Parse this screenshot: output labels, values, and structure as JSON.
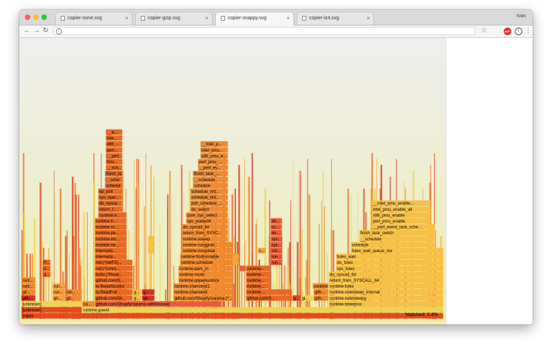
{
  "browser": {
    "tabs": [
      {
        "label": "copier-none.svg",
        "active": false
      },
      {
        "label": "copier-gzip.svg",
        "active": false
      },
      {
        "label": "copier-snappy.svg",
        "active": true
      },
      {
        "label": "copier-lz4.svg",
        "active": false
      }
    ],
    "tab_close_glyph": "×",
    "user_name": "Ivan",
    "url": "",
    "icons": [
      "back-arrow-icon",
      "forward-arrow-icon",
      "reload-icon",
      "info-icon",
      "star-icon",
      "adblock-icon",
      "extension-info-icon",
      "menu-dots-icon"
    ],
    "adblock_label": "ABP"
  },
  "flamegraph": {
    "colors": [
      "#e44b1f",
      "#ea6a24",
      "#ef8a30",
      "#f3a33a",
      "#f6c045",
      "#eed352",
      "#d8332b",
      "#e95c39"
    ],
    "highlight_color": "#d35ad6",
    "frames": [
      {
        "label": "copier",
        "start": 0.0,
        "end": 1.0,
        "depth": 0
      },
      {
        "label": "[unknown]",
        "start": 0.0,
        "end": 0.144,
        "depth": 1
      },
      {
        "label": "runtime.goexit",
        "start": 0.144,
        "end": 1.0,
        "depth": 1
      },
      {
        "label": "[unknown]",
        "start": 0.0,
        "end": 0.144,
        "depth": 2
      },
      {
        "label": "co...",
        "start": 0.144,
        "end": 0.174,
        "depth": 2
      },
      {
        "label": "github.com/Shopify/sarama.withRecover",
        "start": 0.174,
        "end": 0.472,
        "depth": 2
      },
      {
        "label": "runtime.timerproc",
        "start": 0.728,
        "end": 1.0,
        "depth": 2
      },
      {
        "label": "runtime.notetsleepg",
        "start": 0.728,
        "end": 1.0,
        "depth": 3
      },
      {
        "label": "runtime.notetsleep_internal",
        "start": 0.728,
        "end": 1.0,
        "depth": 4
      },
      {
        "label": "runtime.futex",
        "start": 0.728,
        "end": 1.0,
        "depth": 5
      },
      {
        "label": "return_from_SYSCALL_64",
        "start": 0.728,
        "end": 1.0,
        "depth": 6
      },
      {
        "label": "do_syscall_64",
        "start": 0.728,
        "end": 1.0,
        "depth": 7
      },
      {
        "label": "sys_futex",
        "start": 0.745,
        "end": 1.0,
        "depth": 8
      },
      {
        "label": "do_futex",
        "start": 0.745,
        "end": 1.0,
        "depth": 9
      },
      {
        "label": "futex_wait",
        "start": 0.745,
        "end": 1.0,
        "depth": 10
      },
      {
        "label": "futex_wait_queue_me",
        "start": 0.78,
        "end": 1.0,
        "depth": 11
      },
      {
        "label": "schedule",
        "start": 0.78,
        "end": 0.98,
        "depth": 12
      },
      {
        "label": "__schedule",
        "start": 0.8,
        "end": 0.98,
        "depth": 13
      },
      {
        "label": "finish_task_switch",
        "start": 0.8,
        "end": 0.98,
        "depth": 14
      },
      {
        "label": "__perf_event_task_sche...",
        "start": 0.83,
        "end": 0.98,
        "depth": 15
      },
      {
        "label": "perf_pmu_enable",
        "start": 0.83,
        "end": 0.97,
        "depth": 16
      },
      {
        "label": "x86_pmu_enable",
        "start": 0.83,
        "end": 0.97,
        "depth": 17
      },
      {
        "label": "intel_pmu_enable_all",
        "start": 0.83,
        "end": 0.97,
        "depth": 18
      },
      {
        "label": "__intel_pmu_enable...",
        "start": 0.83,
        "end": 0.97,
        "depth": 19
      },
      {
        "label": "github.com/Sh...",
        "start": 0.174,
        "end": 0.264,
        "depth": 3
      },
      {
        "label": "io.ReadFull",
        "start": 0.174,
        "end": 0.264,
        "depth": 4
      },
      {
        "label": "io.ReadAtLeast",
        "start": 0.174,
        "end": 0.264,
        "depth": 5
      },
      {
        "label": "github.com/S...",
        "start": 0.174,
        "end": 0.264,
        "depth": 6
      },
      {
        "label": "bufio.(*Read...",
        "start": 0.174,
        "end": 0.264,
        "depth": 7
      },
      {
        "label": "net.(*conn)...",
        "start": 0.174,
        "end": 0.264,
        "depth": 8
      },
      {
        "label": "net.(*netFD)...",
        "start": 0.174,
        "end": 0.264,
        "depth": 9
      },
      {
        "label": "internal/p...",
        "start": 0.174,
        "end": 0.25,
        "depth": 10
      },
      {
        "label": "internal/p...",
        "start": 0.174,
        "end": 0.25,
        "depth": 11
      },
      {
        "label": "runtime.ne...",
        "start": 0.174,
        "end": 0.25,
        "depth": 12
      },
      {
        "label": "runtime.mc...",
        "start": 0.174,
        "end": 0.25,
        "depth": 13
      },
      {
        "label": "runtime.pa...",
        "start": 0.174,
        "end": 0.25,
        "depth": 14
      },
      {
        "label": "runtime.sc...",
        "start": 0.174,
        "end": 0.25,
        "depth": 15
      },
      {
        "label": "runtime.fi...",
        "start": 0.174,
        "end": 0.25,
        "depth": 16
      },
      {
        "label": "runtime.e...",
        "start": 0.182,
        "end": 0.25,
        "depth": 17
      },
      {
        "label": "return_f...",
        "start": 0.182,
        "end": 0.24,
        "depth": 18
      },
      {
        "label": "do_sysca...",
        "start": 0.182,
        "end": 0.24,
        "depth": 19
      },
      {
        "label": "sys_epol...",
        "start": 0.182,
        "end": 0.24,
        "depth": 20
      },
      {
        "label": "ep_poll",
        "start": 0.182,
        "end": 0.24,
        "depth": 21
      },
      {
        "label": "schedule",
        "start": 0.198,
        "end": 0.24,
        "depth": 22
      },
      {
        "label": "__schedule",
        "start": 0.198,
        "end": 0.24,
        "depth": 23
      },
      {
        "label": "finish_ta...",
        "start": 0.198,
        "end": 0.24,
        "depth": 24
      },
      {
        "label": "__sch...",
        "start": 0.2,
        "end": 0.24,
        "depth": 25
      },
      {
        "label": "finis...",
        "start": 0.2,
        "end": 0.24,
        "depth": 26
      },
      {
        "label": "__perf...",
        "start": 0.2,
        "end": 0.24,
        "depth": 27
      },
      {
        "label": "perf...",
        "start": 0.2,
        "end": 0.24,
        "depth": 28
      },
      {
        "label": "x86_...",
        "start": 0.2,
        "end": 0.24,
        "depth": 29
      },
      {
        "label": "inte...",
        "start": 0.2,
        "end": 0.24,
        "depth": 30
      },
      {
        "label": "__in...",
        "start": 0.2,
        "end": 0.24,
        "depth": 31
      },
      {
        "label": "github.com/Shopify/sarama.(*...",
        "start": 0.36,
        "end": 0.502,
        "depth": 3
      },
      {
        "label": "runtime.chansend",
        "start": 0.36,
        "end": 0.502,
        "depth": 4
      },
      {
        "label": "runtime.chansend1",
        "start": 0.36,
        "end": 0.502,
        "depth": 5
      },
      {
        "label": "runtime.goparkunlock",
        "start": 0.372,
        "end": 0.502,
        "depth": 6
      },
      {
        "label": "runtime.mcall",
        "start": 0.372,
        "end": 0.502,
        "depth": 7
      },
      {
        "label": "runtime.park_m",
        "start": 0.372,
        "end": 0.502,
        "depth": 8
      },
      {
        "label": "runtime.schedule",
        "start": 0.376,
        "end": 0.502,
        "depth": 9
      },
      {
        "label": "runtime.findrunnable",
        "start": 0.376,
        "end": 0.502,
        "depth": 10
      },
      {
        "label": "runtime.runqsteal",
        "start": 0.38,
        "end": 0.502,
        "depth": 11
      },
      {
        "label": "runtime.runqgrab",
        "start": 0.38,
        "end": 0.502,
        "depth": 12
      },
      {
        "label": "runtime.usleep",
        "start": 0.38,
        "end": 0.49,
        "depth": 13
      },
      {
        "label": "return_from_SYSC...",
        "start": 0.38,
        "end": 0.49,
        "depth": 14
      },
      {
        "label": "do_syscall_64",
        "start": 0.38,
        "end": 0.49,
        "depth": 15
      },
      {
        "label": "sys_pselect6",
        "start": 0.39,
        "end": 0.49,
        "depth": 16
      },
      {
        "label": "core_sys_select",
        "start": 0.39,
        "end": 0.49,
        "depth": 17
      },
      {
        "label": "do_select",
        "start": 0.4,
        "end": 0.49,
        "depth": 18
      },
      {
        "label": "poll_schedule_...",
        "start": 0.4,
        "end": 0.49,
        "depth": 19
      },
      {
        "label": "schedule_hrti...",
        "start": 0.4,
        "end": 0.49,
        "depth": 20
      },
      {
        "label": "schedule_hrti...",
        "start": 0.4,
        "end": 0.49,
        "depth": 21
      },
      {
        "label": "schedule",
        "start": 0.406,
        "end": 0.49,
        "depth": 22
      },
      {
        "label": "__schedule",
        "start": 0.406,
        "end": 0.49,
        "depth": 23
      },
      {
        "label": "finish_task_...",
        "start": 0.406,
        "end": 0.49,
        "depth": 24
      },
      {
        "label": "__perf_ev...",
        "start": 0.418,
        "end": 0.49,
        "depth": 25
      },
      {
        "label": "perf_pmu_...",
        "start": 0.418,
        "end": 0.49,
        "depth": 26
      },
      {
        "label": "x86_pmu_e...",
        "start": 0.424,
        "end": 0.49,
        "depth": 27
      },
      {
        "label": "intel_pmu...",
        "start": 0.424,
        "end": 0.49,
        "depth": 28
      },
      {
        "label": "__intel_p...",
        "start": 0.424,
        "end": 0.49,
        "depth": 29
      },
      {
        "label": "github.com/S...",
        "start": 0.532,
        "end": 0.642,
        "depth": 3
      },
      {
        "label": "runtime....",
        "start": 0.532,
        "end": 0.642,
        "depth": 4
      },
      {
        "label": "runtime...",
        "start": 0.532,
        "end": 0.59,
        "depth": 5
      },
      {
        "label": "runtime...",
        "start": 0.532,
        "end": 0.59,
        "depth": 6
      },
      {
        "label": "runtime...",
        "start": 0.532,
        "end": 0.59,
        "depth": 7
      },
      {
        "label": "runtime...",
        "start": 0.532,
        "end": 0.59,
        "depth": 8
      },
      {
        "label": "git...",
        "start": 0.0,
        "end": 0.034,
        "depth": 4
      },
      {
        "label": "runt...",
        "start": 0.0,
        "end": 0.034,
        "depth": 5
      },
      {
        "label": "runt...",
        "start": 0.0,
        "end": 0.034,
        "depth": 6
      },
      {
        "label": "gith...",
        "start": 0.0,
        "end": 0.034,
        "depth": 3
      },
      {
        "label": "git...",
        "start": 0.074,
        "end": 0.104,
        "depth": 3
      },
      {
        "label": "run...",
        "start": 0.074,
        "end": 0.104,
        "depth": 4
      },
      {
        "label": "run...",
        "start": 0.074,
        "end": 0.104,
        "depth": 5
      },
      {
        "label": "git...",
        "start": 0.104,
        "end": 0.144,
        "depth": 3
      },
      {
        "label": "run...",
        "start": 0.104,
        "end": 0.144,
        "depth": 4
      },
      {
        "label": "g...",
        "start": 0.264,
        "end": 0.286,
        "depth": 3
      },
      {
        "label": "g...",
        "start": 0.264,
        "end": 0.286,
        "depth": 4
      },
      {
        "label": "git...",
        "start": 0.286,
        "end": 0.316,
        "depth": 3
      },
      {
        "label": "g...",
        "start": 0.286,
        "end": 0.316,
        "depth": 4
      },
      {
        "label": "g...",
        "start": 0.642,
        "end": 0.662,
        "depth": 3
      },
      {
        "label": "gi...",
        "start": 0.662,
        "end": 0.692,
        "depth": 3
      },
      {
        "label": "gith...",
        "start": 0.692,
        "end": 0.728,
        "depth": 3
      },
      {
        "label": "gith...",
        "start": 0.692,
        "end": 0.728,
        "depth": 4
      },
      {
        "label": "runtime.notesleep",
        "start": 0.69,
        "end": 0.728,
        "depth": 5
      },
      {
        "label": "s...",
        "start": 0.5,
        "end": 0.516,
        "depth": 9
      },
      {
        "label": "s...",
        "start": 0.5,
        "end": 0.516,
        "depth": 10
      },
      {
        "label": "s...",
        "start": 0.56,
        "end": 0.58,
        "depth": 11
      },
      {
        "label": "n...",
        "start": 0.516,
        "end": 0.532,
        "depth": 8
      },
      {
        "label": "run...",
        "start": 0.59,
        "end": 0.618,
        "depth": 9
      },
      {
        "label": "run...",
        "start": 0.59,
        "end": 0.618,
        "depth": 10
      },
      {
        "label": "run...",
        "start": 0.59,
        "end": 0.618,
        "depth": 11
      },
      {
        "label": "sys...",
        "start": 0.59,
        "end": 0.618,
        "depth": 12
      },
      {
        "label": "sys...",
        "start": 0.59,
        "end": 0.618,
        "depth": 13
      },
      {
        "label": "do...",
        "start": 0.59,
        "end": 0.618,
        "depth": 14
      },
      {
        "label": "ru...",
        "start": 0.59,
        "end": 0.618,
        "depth": 15
      },
      {
        "label": "do...",
        "start": 0.59,
        "end": 0.618,
        "depth": 16
      },
      {
        "label": "d...",
        "start": 0.05,
        "end": 0.07,
        "depth": 7
      },
      {
        "label": "d...",
        "start": 0.05,
        "end": 0.07,
        "depth": 8
      },
      {
        "label": "P...",
        "start": 0.05,
        "end": 0.07,
        "depth": 9
      },
      {
        "label": "g...",
        "start": 0.3,
        "end": 0.316,
        "depth": 11
      },
      {
        "label": "g...",
        "start": 0.3,
        "end": 0.316,
        "depth": 12
      },
      {
        "label": "g...",
        "start": 0.3,
        "end": 0.316,
        "depth": 13
      }
    ],
    "highlights": [
      11,
      12
    ],
    "matched_label": "Matched: 2.4%"
  }
}
